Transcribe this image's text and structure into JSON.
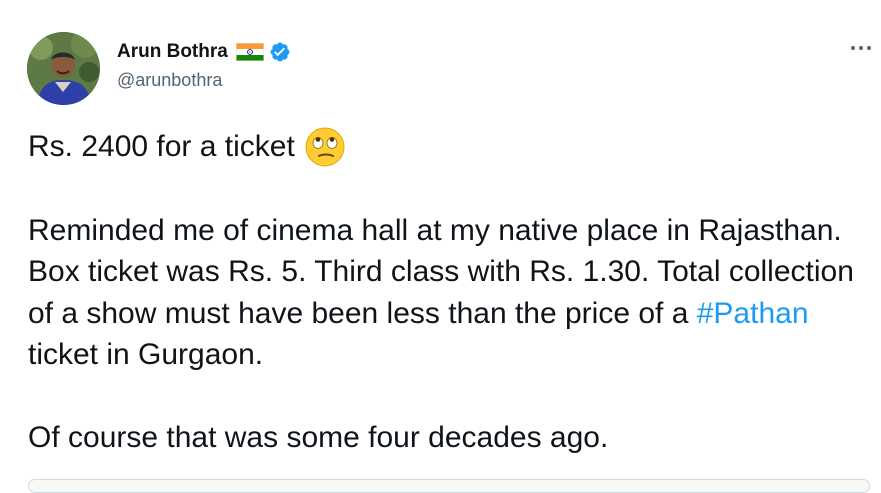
{
  "author": {
    "display_name": "Arun Bothra",
    "handle": "@arunbothra",
    "flag_icon": "india-flag-icon",
    "verified_icon": "verified-badge-icon"
  },
  "tweet": {
    "line1": "Rs. 2400 for a ticket",
    "line1_emoji": "face-with-rolling-eyes",
    "para2_before": "Reminded me of cinema hall at my native place in Rajasthan. Box ticket was Rs. 5. Third class with Rs. 1.30. Total collection of a show must have been less than the price of a ",
    "hashtag": "#Pathan",
    "para2_after": " ticket in Gurgaon.",
    "para3": "Of course that was some four decades ago."
  },
  "colors": {
    "link": "#1d9bf0",
    "verified": "#1d9bf0",
    "secondary_text": "#536471",
    "primary_text": "#0f1419"
  }
}
